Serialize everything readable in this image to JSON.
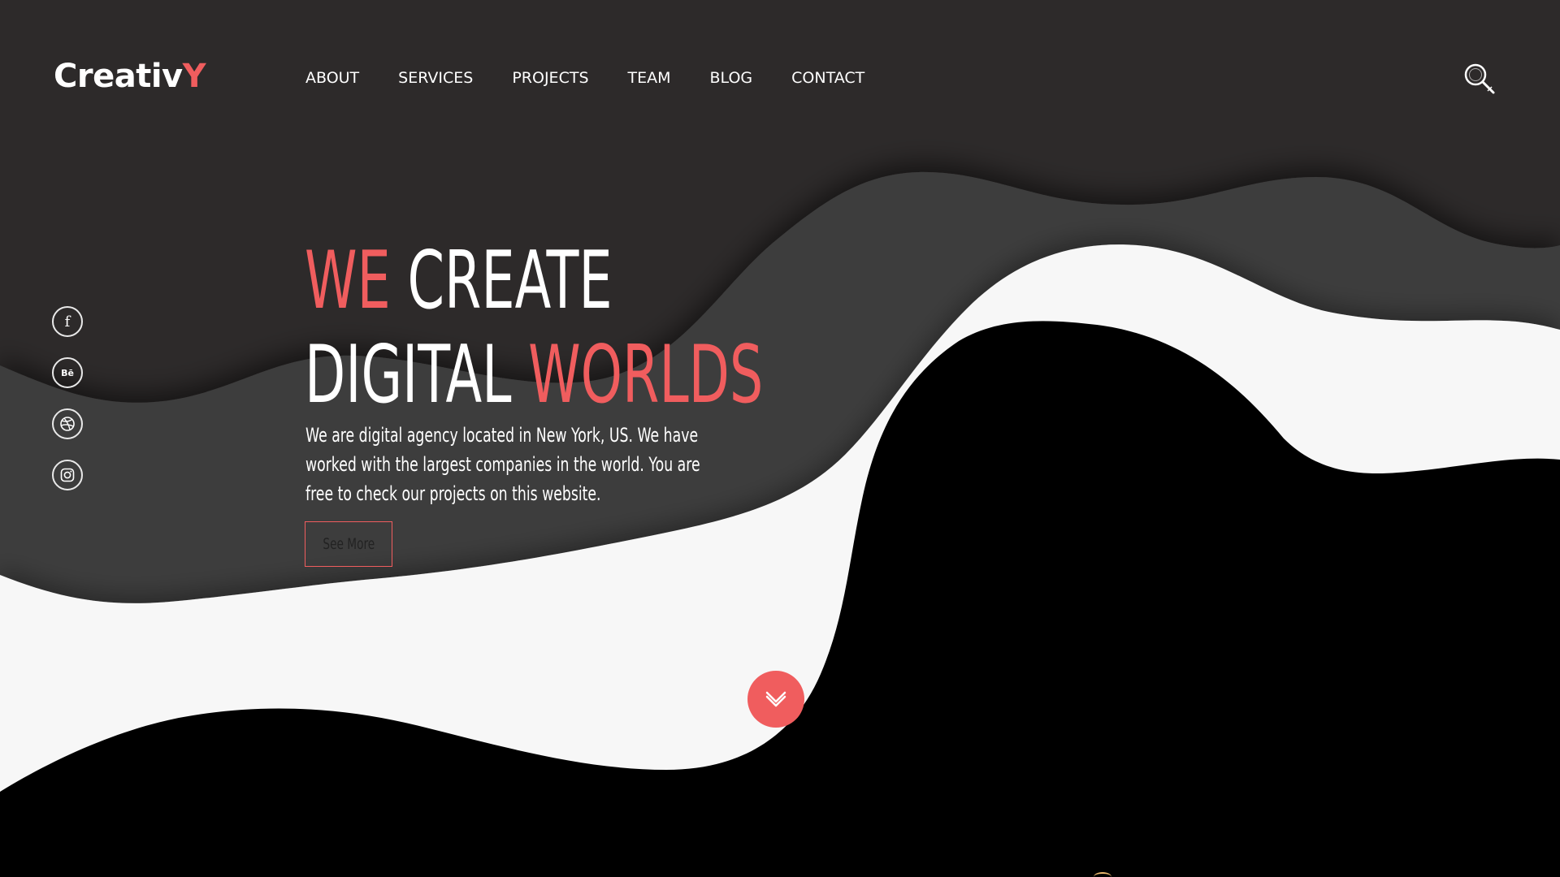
{
  "colors": {
    "accent": "#f05d5e",
    "dark_bg": "#2d2a2a",
    "mid_wave": "#3d3c3c",
    "light_wave": "#f7f7f7",
    "black_wave": "#000000"
  },
  "header": {
    "logo_main": "Creativ",
    "logo_accent": "Y",
    "nav": [
      "ABOUT",
      "SERVICES",
      "PROJECTS",
      "TEAM",
      "BLOG",
      "CONTACT"
    ],
    "search_icon": "search-icon"
  },
  "social": [
    {
      "name": "facebook",
      "icon": "facebook-icon",
      "glyph": "f"
    },
    {
      "name": "behance",
      "icon": "behance-icon",
      "glyph": "Bē"
    },
    {
      "name": "dribbble",
      "icon": "dribbble-icon",
      "glyph": ""
    },
    {
      "name": "instagram",
      "icon": "instagram-icon",
      "glyph": ""
    }
  ],
  "hero": {
    "title_line1_accent": "WE",
    "title_line1_rest": " CREATE",
    "title_line2_rest": "DIGITAL ",
    "title_line2_accent": "WORLDS",
    "description": "We are digital agency located in New York, US. We have worked with the largest companies in the world. You are free to check our projects on this website.",
    "cta_label": "See More",
    "scroll_icon": "chevron-down-icon"
  }
}
